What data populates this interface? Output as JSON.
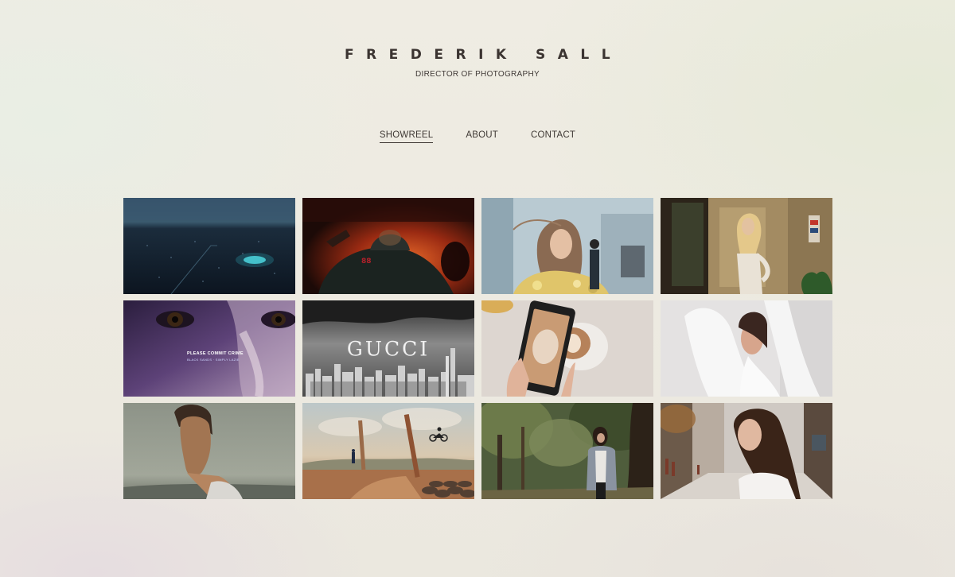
{
  "header": {
    "title": "FREDERIK SALL",
    "subtitle": "DIRECTOR OF PHOTOGRAPHY"
  },
  "nav": {
    "items": [
      {
        "label": "SHOWREEL",
        "active": true
      },
      {
        "label": "ABOUT",
        "active": false
      },
      {
        "label": "CONTACT",
        "active": false
      }
    ]
  },
  "gallery": {
    "tiles": [
      {
        "subject": "aerial night city"
      },
      {
        "subject": "man in red hoodie"
      },
      {
        "subject": "woman with windblown hair"
      },
      {
        "subject": "blonde woman in interior"
      },
      {
        "subject": "close-up eyes",
        "caption": "PLEASE COMMIT CRIME",
        "caption_small": "BLACK SANDS · SIMPLY LAZIE"
      },
      {
        "subject": "city skyline",
        "caption": "GUCCI"
      },
      {
        "subject": "phone with coffee"
      },
      {
        "subject": "woman in white"
      },
      {
        "subject": "man portrait"
      },
      {
        "subject": "desert motocross"
      },
      {
        "subject": "woman among trees"
      },
      {
        "subject": "woman on street"
      }
    ]
  }
}
